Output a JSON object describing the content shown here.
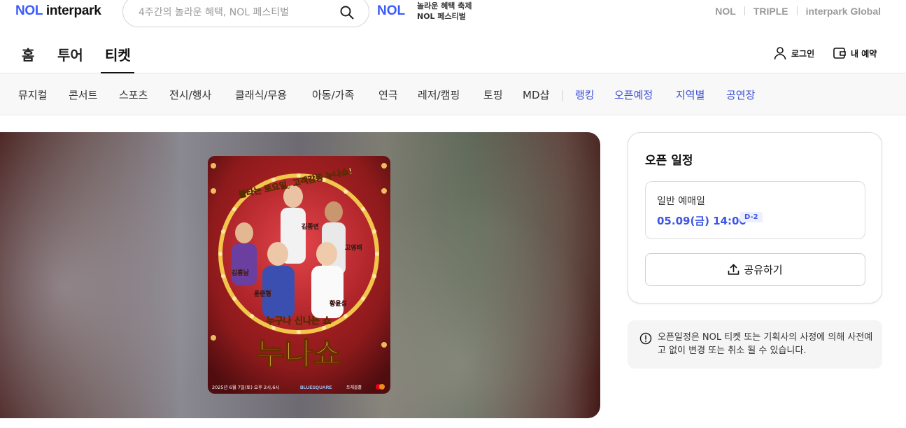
{
  "header": {
    "logo_prefix": "NOL",
    "logo_suffix": " interpark",
    "search_placeholder": "4주간의 놀라운 혜택, NOL 페스티벌",
    "promo_logo": "NOL",
    "promo_line1": "놀라운 혜택 축제",
    "promo_line2": "NOL 페스티벌",
    "family_links": [
      "NOL",
      "TRIPLE",
      "interpark Global"
    ]
  },
  "main_tabs": [
    {
      "label": "홈",
      "active": false
    },
    {
      "label": "투어",
      "active": false
    },
    {
      "label": "티켓",
      "active": true
    }
  ],
  "user_menu": {
    "login": "로그인",
    "my_booking": "내 예약"
  },
  "categories": [
    "뮤지컬",
    "콘서트",
    "스포츠",
    "전시/행사",
    "클래식/무용",
    "아동/가족",
    "연극",
    "레저/캠핑",
    "토핑",
    "MD샵"
  ],
  "highlight_categories": [
    "랭킹",
    "오픈예정",
    "지역별",
    "공연장"
  ],
  "poster": {
    "banner": "불타는 토요일, 고객감동 누나쇼!",
    "names": [
      "김종연",
      "고영태",
      "김홍남",
      "윤준협",
      "황윤성"
    ],
    "tagline": "누구나 신나는 쇼",
    "title": "누나쇼",
    "footer_date": "2025년 6월 7일(토) 오후 2시,6시",
    "sponsor1": "BLUESQUARE",
    "sponsor2": "트래블홀",
    "colors": {
      "background": "#8e1a1c",
      "gold": "#f2c64a",
      "bulb": "#ffe7a8"
    }
  },
  "schedule": {
    "title": "오픈 일정",
    "label": "일반 예매일",
    "date": "05.09(금) 14:00",
    "dday": "D-2",
    "share": "공유하기"
  },
  "notice": {
    "text": "오픈일정은 NOL 티켓 또는 기획사의 사정에 의해 사전예고 없이 변경 또는 취소 될 수 있습니다."
  },
  "colors": {
    "brand_blue": "#3b5bfd",
    "link_blue": "#3b4fd8",
    "date_blue": "#3b55e6"
  }
}
